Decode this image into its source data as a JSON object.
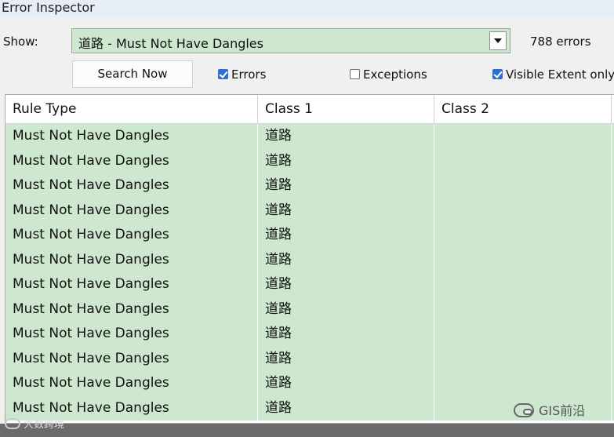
{
  "window": {
    "title": "Error Inspector"
  },
  "filter": {
    "show_label": "Show:",
    "selected": "道路 - Must Not Have Dangles",
    "error_count": "788 errors"
  },
  "search_button": "Search Now",
  "checkboxes": {
    "errors": {
      "label": "Errors",
      "checked": true
    },
    "exceptions": {
      "label": "Exceptions",
      "checked": false
    },
    "visible_extent": {
      "label": "Visible Extent only",
      "checked": true
    }
  },
  "table": {
    "columns": [
      "Rule Type",
      "Class 1",
      "Class 2"
    ],
    "rows": [
      [
        "Must Not Have Dangles",
        "道路",
        ""
      ],
      [
        "Must Not Have Dangles",
        "道路",
        ""
      ],
      [
        "Must Not Have Dangles",
        "道路",
        ""
      ],
      [
        "Must Not Have Dangles",
        "道路",
        ""
      ],
      [
        "Must Not Have Dangles",
        "道路",
        ""
      ],
      [
        "Must Not Have Dangles",
        "道路",
        ""
      ],
      [
        "Must Not Have Dangles",
        "道路",
        ""
      ],
      [
        "Must Not Have Dangles",
        "道路",
        ""
      ],
      [
        "Must Not Have Dangles",
        "道路",
        ""
      ],
      [
        "Must Not Have Dangles",
        "道路",
        ""
      ],
      [
        "Must Not Have Dangles",
        "道路",
        ""
      ],
      [
        "Must Not Have Dangles",
        "道路",
        ""
      ]
    ]
  },
  "watermarks": {
    "right": "GIS前沿",
    "bottom": "大数跨境"
  },
  "colors": {
    "row_bg": "#cde8cf",
    "checkbox_on": "#2f6fd0",
    "titlebar": "#e7eef8"
  },
  "icons": {
    "dropdown": "chevron-down-icon",
    "watermark": "wechat-icon"
  }
}
